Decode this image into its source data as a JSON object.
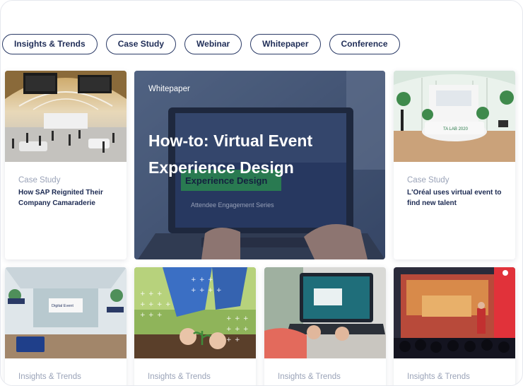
{
  "filters": [
    {
      "label": "Insights & Trends"
    },
    {
      "label": "Case Study"
    },
    {
      "label": "Webinar"
    },
    {
      "label": "Whitepaper"
    },
    {
      "label": "Conference"
    }
  ],
  "featured": {
    "category": "Whitepaper",
    "title": "How-to: Virtual Event Experience Design",
    "laptop_screen_title": "Experience Design",
    "laptop_screen_subtitle": "Attendee Engagement Series"
  },
  "cards_top": [
    {
      "category": "Case Study",
      "title": "How SAP Reignited Their Company Camaraderie"
    },
    {
      "category": "Case Study",
      "title": "L'Oréal uses virtual event to find new talent",
      "booth_label": "TA LAB 2020"
    }
  ],
  "cards_bottom": [
    {
      "category": "Insights & Trends",
      "screen_label": "Digital Event"
    },
    {
      "category": "Insights & Trends"
    },
    {
      "category": "Insights & Trends"
    },
    {
      "category": "Insights & Trends"
    }
  ],
  "colors": {
    "chip_border": "#2a3a66",
    "title": "#1c2a52",
    "category": "#9aa3b8"
  }
}
